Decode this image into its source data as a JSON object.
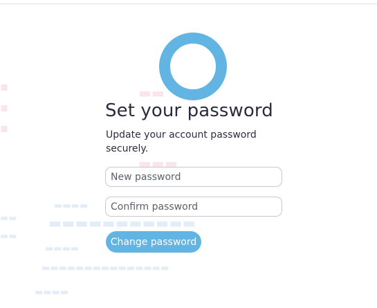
{
  "brand": {
    "logo_icon": "ring-logo-icon",
    "logo_color": "#62B4E2"
  },
  "page": {
    "title": "Set your password",
    "subtitle": "Update your account password securely."
  },
  "form": {
    "new_password": {
      "placeholder": "New password",
      "value": ""
    },
    "confirm_password": {
      "placeholder": "Confirm password",
      "value": ""
    },
    "submit_label": "Change password",
    "submit_color": "#62B4E2"
  }
}
